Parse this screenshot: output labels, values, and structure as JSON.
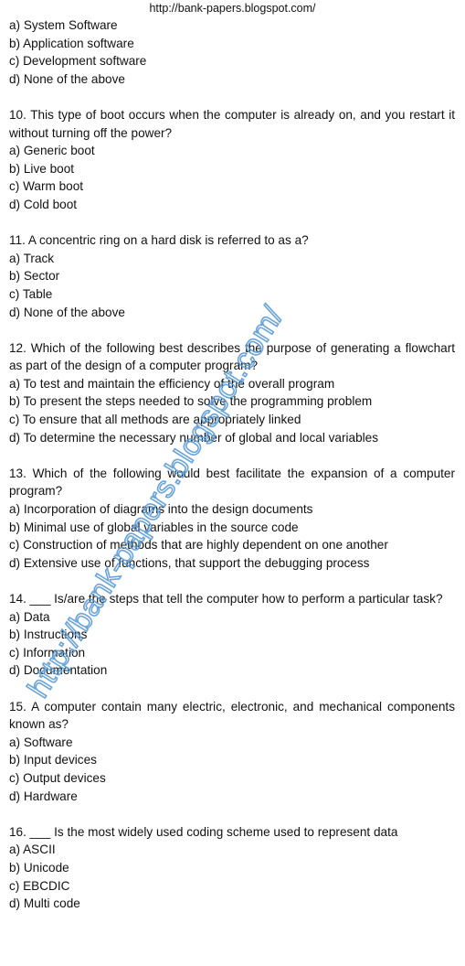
{
  "header": {
    "url": "http://bank-papers.blogspot.com/"
  },
  "watermark": {
    "text": "http://bank-papers.blogspot.com/",
    "color": "#5b9bd5"
  },
  "continued_options": [
    "a) System Software",
    "b) Application software",
    "c) Development software",
    "d) None of the above"
  ],
  "questions": [
    {
      "text": "10. This type of boot occurs when the computer is already on, and you restart it without turning off the power?",
      "options": [
        "a) Generic boot",
        "b) Live boot",
        "c) Warm boot",
        "d) Cold boot"
      ]
    },
    {
      "text": "11. A concentric ring on a hard disk is referred to as a?",
      "options": [
        "a) Track",
        "b) Sector",
        "c) Table",
        "d) None of the above"
      ]
    },
    {
      "text": "12. Which of the following best describes the purpose of generating a flowchart as part of the design of a computer program?",
      "options": [
        "a) To test and maintain the efficiency of the overall program",
        "b) To present the steps needed to solve the programming problem",
        "c) To ensure that all methods are appropriately linked",
        "d) To determine the necessary number of global and local variables"
      ]
    },
    {
      "text": "13. Which of the following would best facilitate the expansion of a computer program?",
      "options": [
        "a) Incorporation of diagrams into the design documents",
        "b) Minimal use of global variables in the source code",
        "c) Construction of methods that are highly dependent on one another",
        "d) Extensive use of functions, that support the debugging process"
      ]
    },
    {
      "text": "14. ___ Is/are the steps that tell the computer how to perform a particular task?",
      "options": [
        "a) Data",
        "b) Instructions",
        "c) Information",
        "d) Documentation"
      ]
    },
    {
      "text": "15. A computer contain many electric, electronic, and mechanical components known as?",
      "options": [
        "a) Software",
        "b) Input devices",
        "c) Output devices",
        "d) Hardware"
      ]
    },
    {
      "text": "16. ___ Is the most widely used coding scheme used to represent data",
      "options": [
        "a) ASCII",
        "b) Unicode",
        "c) EBCDIC",
        "d) Multi code"
      ]
    }
  ]
}
